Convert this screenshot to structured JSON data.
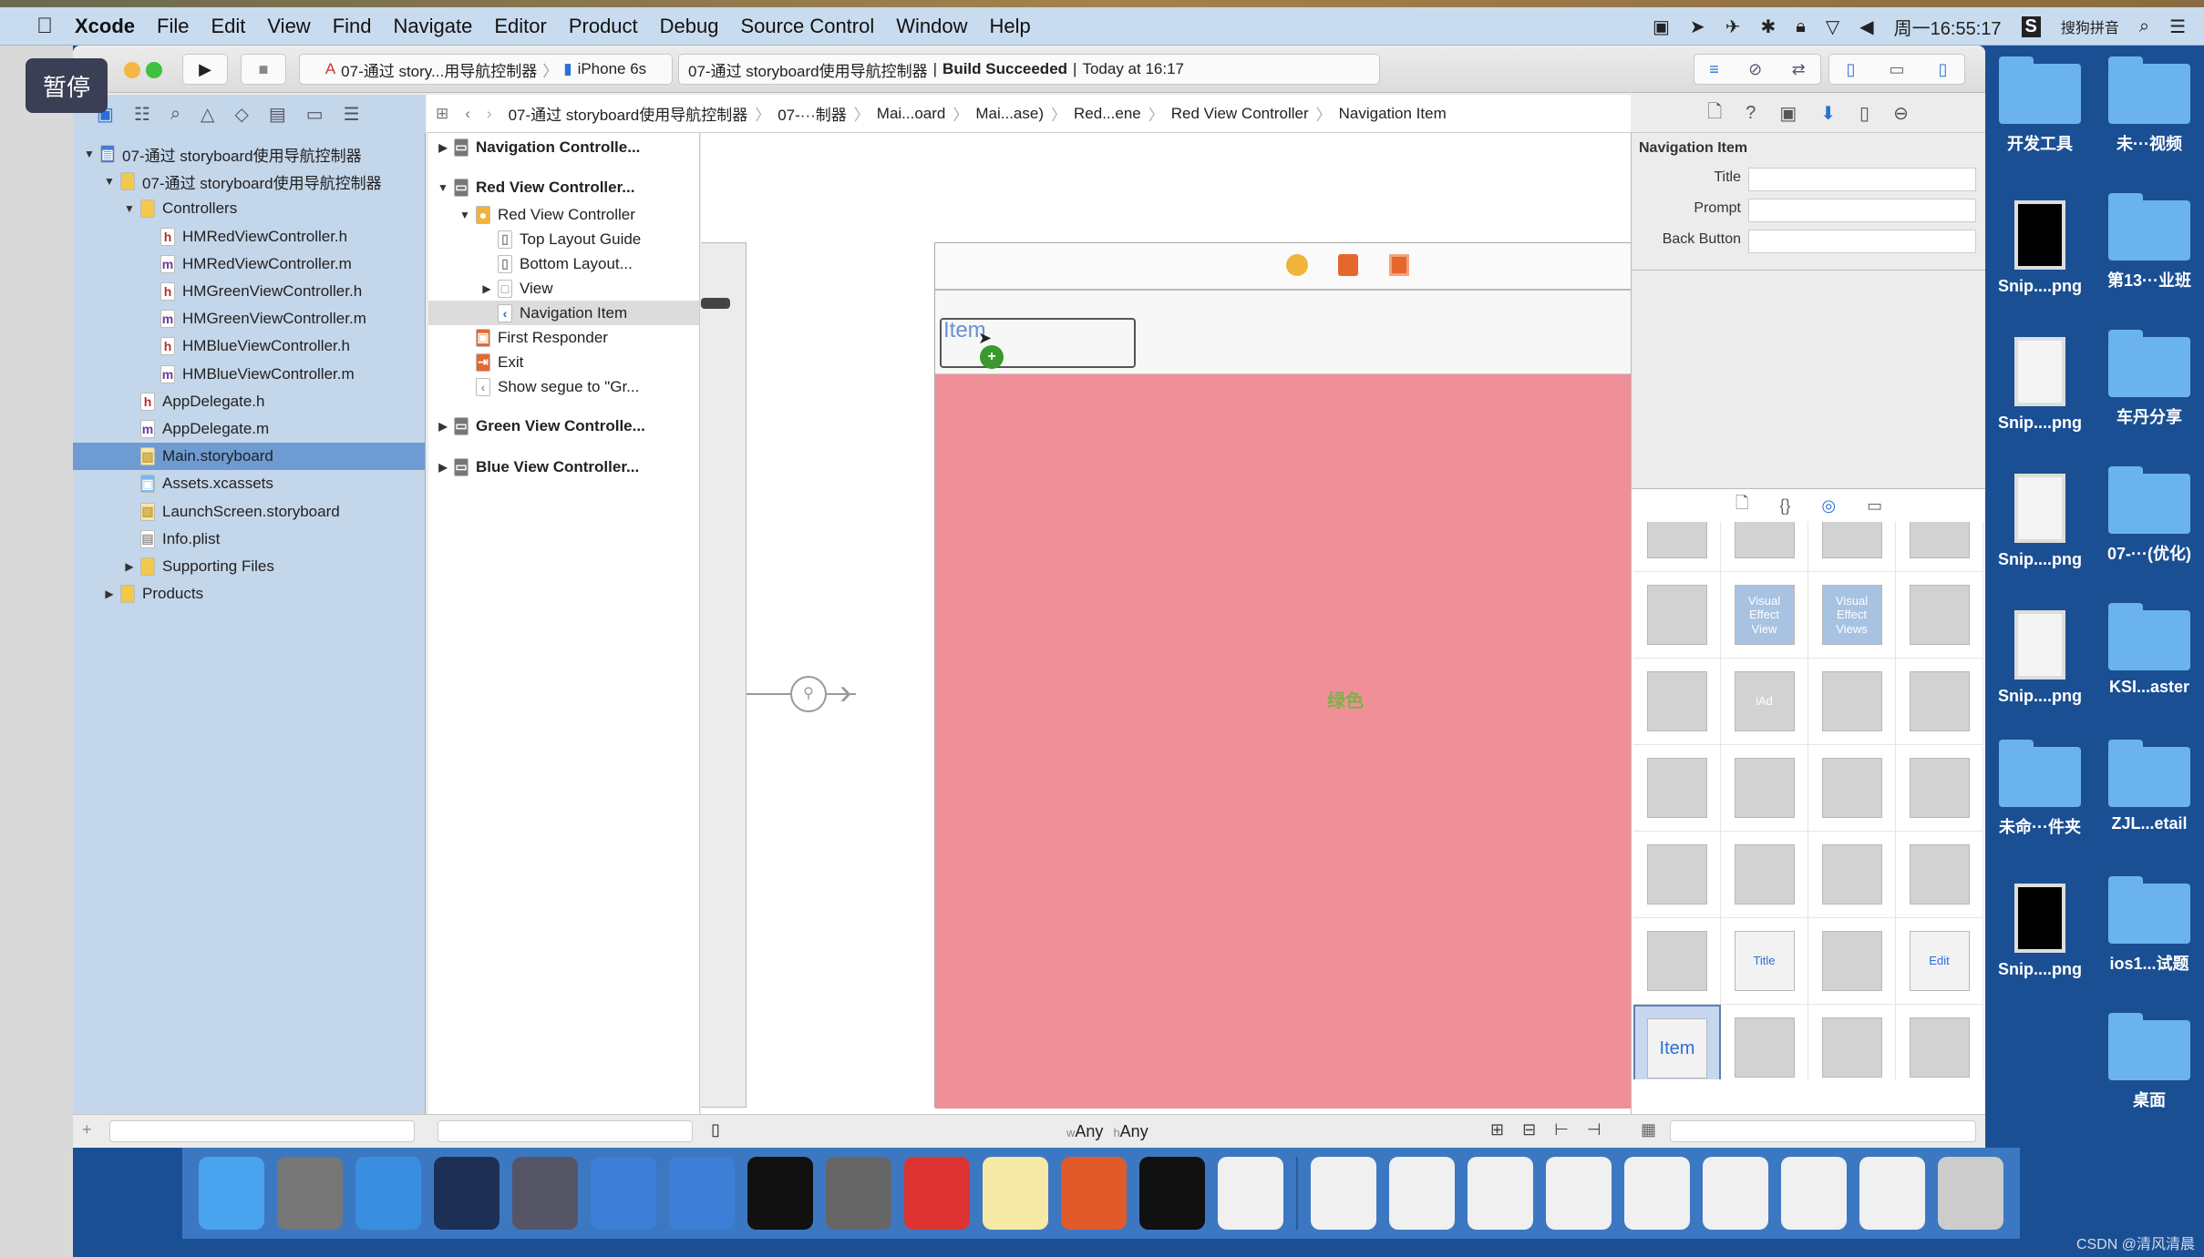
{
  "overlay": {
    "pause": "暂停"
  },
  "menubar": {
    "app": "Xcode",
    "items": [
      "File",
      "Edit",
      "View",
      "Find",
      "Navigate",
      "Editor",
      "Product",
      "Debug",
      "Source Control",
      "Window",
      "Help"
    ],
    "clock": "周一16:55:17",
    "input_method": "搜狗拼音"
  },
  "toolbar": {
    "scheme": "07-通过 story...用导航控制器",
    "device": "iPhone 6s",
    "status_project": "07-通过 storyboard使用导航控制器",
    "status_build": "Build Succeeded",
    "status_time": "Today at 16:17"
  },
  "jumpbar": [
    "07-通过 storyboard使用导航控制器",
    "07-···制器",
    "Mai...oard",
    "Mai...ase)",
    "Red...ene",
    "Red View Controller",
    "Navigation Item"
  ],
  "navigator": {
    "items": [
      {
        "label": "07-通过 storyboard使用导航控制器",
        "level": 0,
        "icon": "project",
        "tri": "open"
      },
      {
        "label": "07-通过 storyboard使用导航控制器",
        "level": 1,
        "icon": "folder",
        "tri": "open"
      },
      {
        "label": "Controllers",
        "level": 2,
        "icon": "folder",
        "tri": "open"
      },
      {
        "label": "HMRedViewController.h",
        "level": 3,
        "icon": "h"
      },
      {
        "label": "HMRedViewController.m",
        "level": 3,
        "icon": "m"
      },
      {
        "label": "HMGreenViewController.h",
        "level": 3,
        "icon": "h"
      },
      {
        "label": "HMGreenViewController.m",
        "level": 3,
        "icon": "m"
      },
      {
        "label": "HMBlueViewController.h",
        "level": 3,
        "icon": "h"
      },
      {
        "label": "HMBlueViewController.m",
        "level": 3,
        "icon": "m"
      },
      {
        "label": "AppDelegate.h",
        "level": 2,
        "icon": "h"
      },
      {
        "label": "AppDelegate.m",
        "level": 2,
        "icon": "m"
      },
      {
        "label": "Main.storyboard",
        "level": 2,
        "icon": "storyboard",
        "selected": true
      },
      {
        "label": "Assets.xcassets",
        "level": 2,
        "icon": "assets"
      },
      {
        "label": "LaunchScreen.storyboard",
        "level": 2,
        "icon": "storyboard"
      },
      {
        "label": "Info.plist",
        "level": 2,
        "icon": "plist"
      },
      {
        "label": "Supporting Files",
        "level": 2,
        "icon": "folder",
        "tri": "closed"
      },
      {
        "label": "Products",
        "level": 1,
        "icon": "folder",
        "tri": "closed"
      }
    ]
  },
  "outline": {
    "items": [
      {
        "label": "Navigation Controlle...",
        "level": 0,
        "bold": true,
        "tri": "closed",
        "icon": "scene"
      },
      {
        "label": "Red View Controller...",
        "level": 0,
        "bold": true,
        "tri": "open",
        "icon": "scene"
      },
      {
        "label": "Red View Controller",
        "level": 1,
        "tri": "open",
        "icon": "vc"
      },
      {
        "label": "Top Layout Guide",
        "level": 2,
        "icon": "guide"
      },
      {
        "label": "Bottom Layout...",
        "level": 2,
        "icon": "guide"
      },
      {
        "label": "View",
        "level": 2,
        "tri": "closed",
        "icon": "view"
      },
      {
        "label": "Navigation Item",
        "level": 2,
        "icon": "navitem",
        "selected": true
      },
      {
        "label": "First Responder",
        "level": 1,
        "icon": "responder"
      },
      {
        "label": "Exit",
        "level": 1,
        "icon": "exit"
      },
      {
        "label": "Show segue to \"Gr...",
        "level": 1,
        "icon": "segue"
      },
      {
        "label": "Green View Controlle...",
        "level": 0,
        "bold": true,
        "tri": "closed",
        "icon": "scene"
      },
      {
        "label": "Blue View Controller...",
        "level": 0,
        "bold": true,
        "tri": "closed",
        "icon": "scene"
      }
    ]
  },
  "canvas": {
    "item_label": "Item",
    "view_label": "绿色",
    "size_class_w": "w",
    "size_class_w_val": "Any",
    "size_class_h": "h",
    "size_class_h_val": "Any",
    "view_color": "#ef9099"
  },
  "inspector": {
    "section": "Navigation Item",
    "title_label": "Title",
    "title_value": "",
    "prompt_label": "Prompt",
    "prompt_value": "",
    "back_label": "Back Button",
    "back_value": ""
  },
  "library": {
    "cells": [
      "",
      "",
      "",
      "",
      "",
      "Visual Effect View",
      "Visual Effect Views",
      "",
      "",
      "iAd",
      "",
      "",
      "",
      "",
      "",
      "",
      "",
      "",
      "",
      "",
      "",
      "Title",
      "",
      "Edit",
      "Item",
      "",
      "",
      "",
      "",
      "",
      "",
      ""
    ]
  },
  "desktop": {
    "left": [
      "开发工具",
      "Snip....png",
      "Snip....png",
      "Snip....png",
      "Snip....png",
      "未命···件夹",
      "Snip....png"
    ],
    "right": [
      "未···视频",
      "第13···业班",
      "车丹分享",
      "07-···(优化)",
      "KSI...aster",
      "ZJL...etail",
      "ios1...试题",
      "桌面"
    ]
  },
  "dock": [
    "finder",
    "launchpad",
    "safari",
    "mouse",
    "photo-slideshow",
    "xcode",
    "instruments",
    "terminal",
    "system-preferences",
    "xmind",
    "notes",
    "wps-presentation",
    "console",
    "doc1",
    "doc2",
    "doc3",
    "doc4",
    "doc5",
    "doc6",
    "doc7",
    "doc8",
    "doc9",
    "trash"
  ],
  "watermark": "CSDN @清风清晨"
}
